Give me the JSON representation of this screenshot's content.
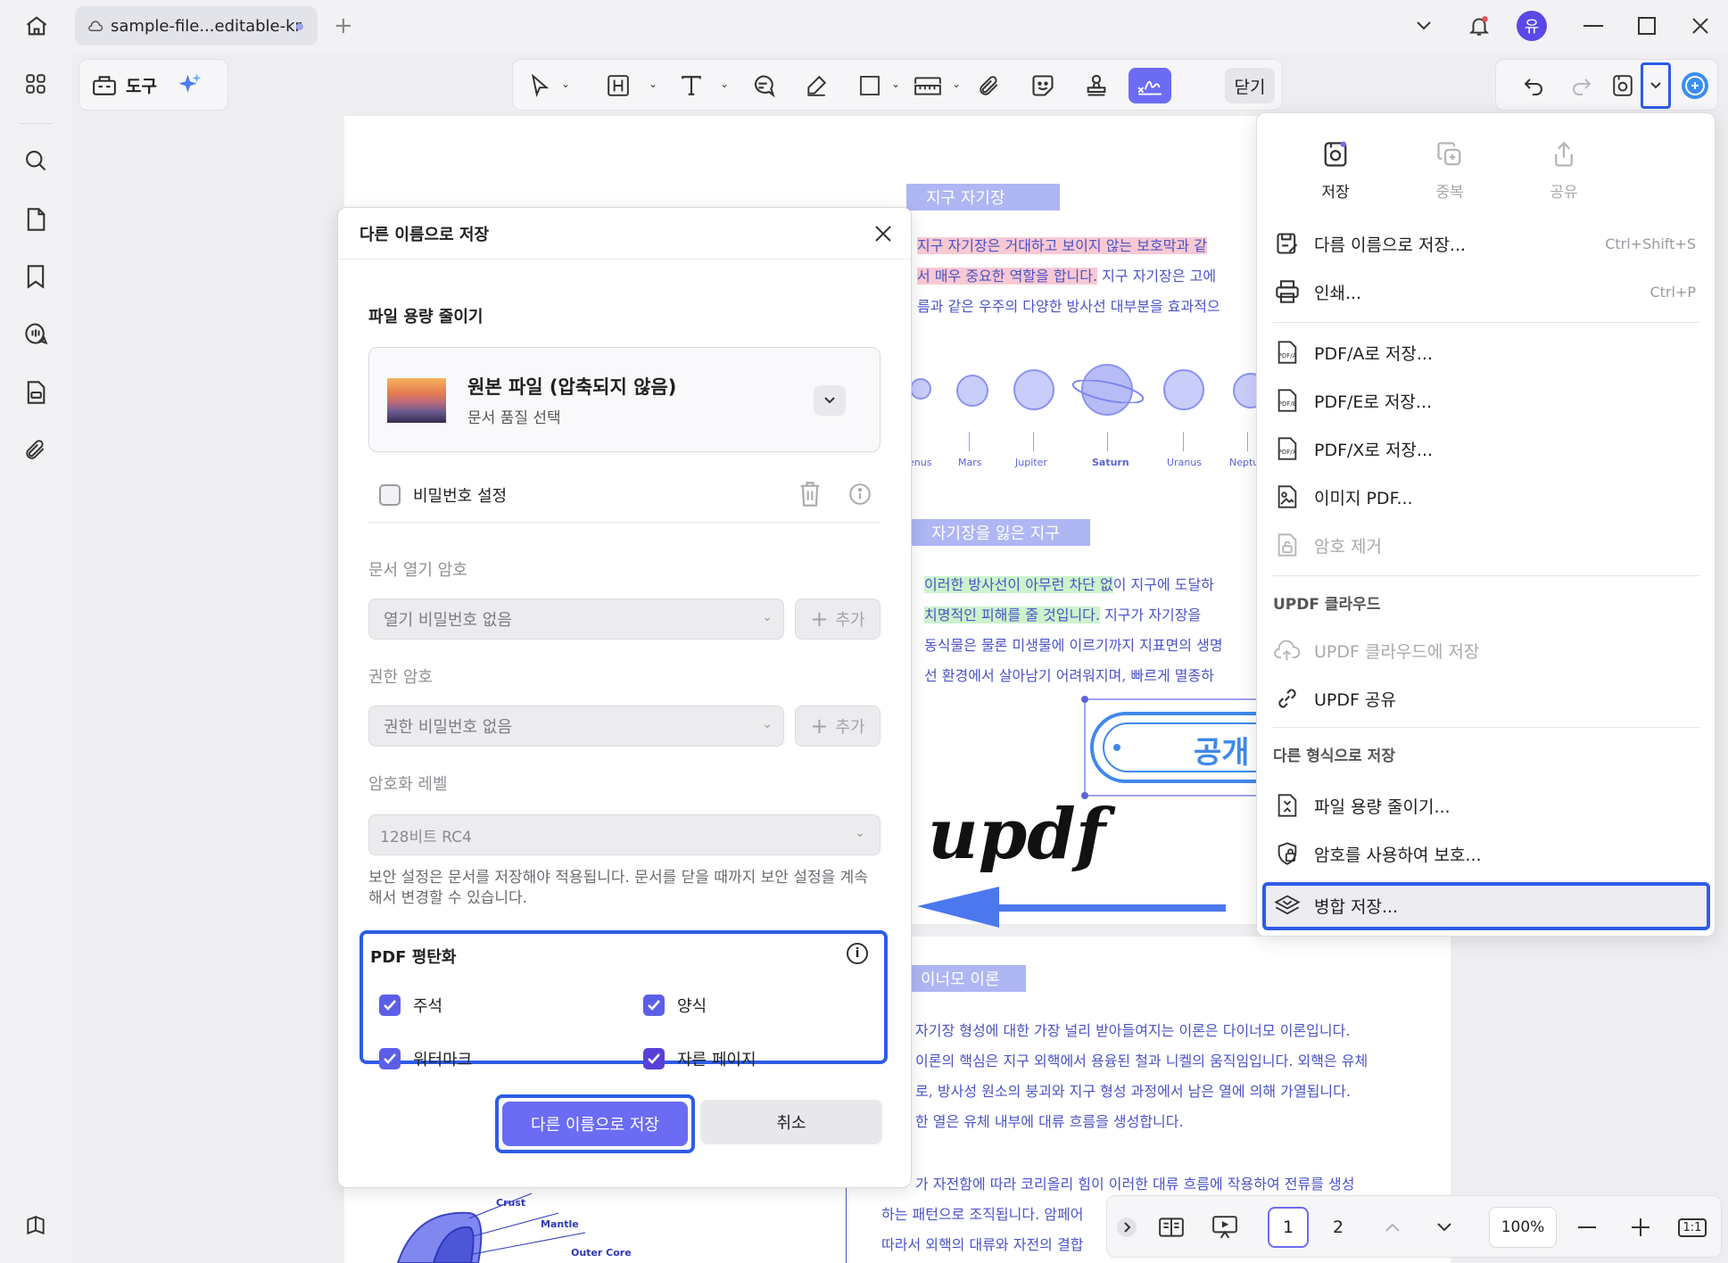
{
  "titlebar": {
    "tab_title": "sample-file...editable-kr",
    "avatar_letter": "유"
  },
  "toolbox": {
    "label": "도구"
  },
  "maintoolbar": {
    "close_label": "닫기"
  },
  "document": {
    "section1_title": "지구 자기장",
    "line1": "지구 자기장은 거대하고 보이지 않는 보호막과 같",
    "line2a": "서 매우 중요한 역할을 합니다.",
    "line2b": " 지구 자기장은 고에",
    "line3": "름과 같은 우주의 다양한 방사선 대부분을 효과적으",
    "planets": [
      "enus",
      "Mars",
      "Jupiter",
      "Saturn",
      "Uranus",
      "Neptu"
    ],
    "section2_title": "자기장을 잃은 지구",
    "s2_line1a": "이러한 방사선이 아무런 차단 없",
    "s2_line1b": "이 지구에 도달하",
    "s2_line2a": "치명적인 피해를 줄 것입니다.",
    "s2_line2b": " 지구가 자기장을",
    "s2_line3": "동식물은 물론 미생물에 이르기까지 지표면의 생명",
    "s2_line4": "선 환경에서 살아남기 어려워지며, 빠르게 멸종하",
    "stamp_text": "공개",
    "signature": "updf",
    "section3_title": "이너모 이론",
    "s3_lines": [
      "자기장 형성에 대한 가장 널리 받아들여지는 이론은 다이너모 이론입니다.",
      "이론의 핵심은 지구 외핵에서 용융된 철과 니켈의 움직임입니다. 외핵은 유체",
      "로, 방사성 원소의 붕괴와 지구 형성 과정에서 남은 열에 의해 가열됩니다.",
      "한 열은 유체 내부에 대류 흐름을 생성합니다."
    ],
    "s3_lines2": [
      "가 자전함에 따라 코리올리 힘이 이러한 대류 흐름에 작용하여 전류를 생성",
      "하는 패턴으로 조직됩니다. 암페어",
      "따라서 외핵의 대류와 자전의 결합"
    ],
    "diagram_labels": [
      "Crust",
      "Mantle",
      "Outer Core"
    ]
  },
  "dialog": {
    "title": "다른 이름으로 저장",
    "reduce_title": "파일 용량 줄이기",
    "quality_title": "원본 파일 (압축되지 않음)",
    "quality_sub": "문서 품질 선택",
    "password_label": "비밀번호 설정",
    "open_pw_label": "문서 열기 암호",
    "open_pw_value": "열기 비밀번호 없음",
    "add_label": "추가",
    "perm_pw_label": "권한 암호",
    "perm_pw_value": "권한 비밀번호 없음",
    "enc_label": "암호화 레벨",
    "enc_value": "128비트 RC4",
    "note": "보안 설정은 문서를 저장해야 적용됩니다. 문서를 닫을 때까지 보안 설정을 계속해서 변경할 수 있습니다.",
    "flatten_title": "PDF 평탄화",
    "flatten": {
      "annotations": "주석",
      "forms": "양식",
      "watermark": "워터마크",
      "crop_pages": "자른 페이지"
    },
    "save_button": "다른 이름으로 저장",
    "cancel_button": "취소"
  },
  "savemenu": {
    "top": {
      "save": "저장",
      "duplicate": "중복",
      "share": "공유"
    },
    "save_as": "다름 이름으로 저장...",
    "save_as_sc": "Ctrl+Shift+S",
    "print": "인쇄...",
    "print_sc": "Ctrl+P",
    "pdfa": "PDF/A로 저장...",
    "pdfe": "PDF/E로 저장...",
    "pdfx": "PDF/X로 저장...",
    "image_pdf": "이미지 PDF...",
    "remove_pw": "암호 제거",
    "cloud_group": "UPDF 클라우드",
    "save_cloud": "UPDF 클라우드에 저장",
    "share_updf": "UPDF 공유",
    "other_group": "다른 형식으로 저장",
    "reduce": "파일 용량 줄이기...",
    "protect": "암호를 사용하여 보호...",
    "merge": "병합 저장..."
  },
  "pager": {
    "page1": "1",
    "page2": "2",
    "zoom": "100%",
    "ratio": "1:1"
  },
  "colors": {
    "accent": "#6b6cf3",
    "highlight_box": "#2d5ce6",
    "doc_text": "#4a53c7"
  }
}
